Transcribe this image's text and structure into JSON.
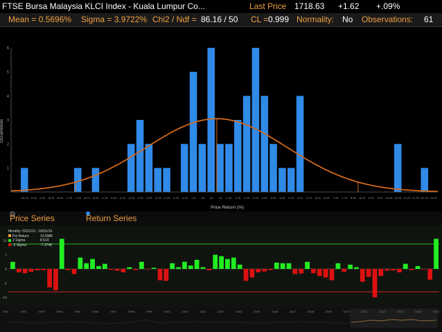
{
  "header": {
    "title": "FTSE Bursa Malaysia KLCI Index - Kuala Lumpur Co...",
    "last_price_label": "Last Price",
    "last_price": "1718.63",
    "change": "+1.62",
    "change_pct": "+.09%"
  },
  "stats": {
    "mean": "Mean = 0.5696%",
    "sigma": "Sigma = 3.9722%",
    "chi2_label": "Chi2 / Ndf =",
    "chi2_value": "86.16 / 50",
    "cl_label": "CL =",
    "cl_value": "0.999",
    "normality_label": "Normality:",
    "normality_value": "No",
    "observations_label": "Observations:",
    "observations_value": "61"
  },
  "tabs": {
    "price_series": "Price Series",
    "return_series": "Return Series"
  },
  "legend": {
    "period": "Monthly: 02/21/11 - 03/31/16",
    "pct_return_label": "Pct Return",
    "pct_return_value": "10.5986",
    "sigma2_label": "2 Sigma",
    "sigma2_value": "8.514",
    "neg_sigma2_label": "-2 Sigma",
    "neg_sigma2_value": "-7.3748"
  },
  "colors": {
    "bar": "#2f8ae8",
    "curve": "#d2691e",
    "pos": "#22ee22",
    "neg": "#dd1111",
    "label": "#f0a040"
  },
  "chart_data": [
    {
      "type": "bar",
      "title": "",
      "xlabel": "Price Return (%)",
      "ylabel": "Occurrences",
      "x": [
        -10.25,
        -7.25,
        -6.25,
        -4.25,
        -3.75,
        -3.25,
        -2.75,
        -2.25,
        -1.25,
        -0.75,
        -0.25,
        0.25,
        0.75,
        1.25,
        1.75,
        2.25,
        2.75,
        3.25,
        3.75,
        4.25,
        4.75,
        5.25,
        10.75,
        12.25
      ],
      "values": [
        1,
        1,
        1,
        2,
        3,
        2,
        1,
        1,
        2,
        5,
        2,
        6,
        2,
        2,
        3,
        4,
        6,
        4,
        2,
        1,
        1,
        4,
        2,
        1,
        1
      ],
      "bin_centers": [
        -10.25,
        -7.25,
        -6.25,
        -4.25,
        -3.75,
        -3.25,
        -2.75,
        -2.25,
        -1.25,
        -0.75,
        -0.25,
        0.25,
        0.75,
        1.25,
        1.75,
        2.25,
        2.75,
        3.25,
        3.75,
        4.25,
        4.75,
        5.25,
        10.75,
        12.25
      ],
      "counts": [
        1,
        1,
        1,
        2,
        3,
        2,
        1,
        1,
        2,
        5,
        2,
        6,
        2,
        2,
        3,
        4,
        6,
        4,
        2,
        1,
        1,
        4,
        2,
        1,
        1
      ],
      "ylim": [
        0,
        6
      ],
      "yticks": [
        "1",
        "2",
        "3",
        "4",
        "5",
        "6"
      ],
      "xticks": [
        "-10.25",
        "-9.75",
        "-9.25",
        "-8.75",
        "-8.25",
        "-7.75",
        "-7.25",
        "-6.75",
        "-6.25",
        "-5.75",
        "-5.25",
        "-4.75",
        "-4.25",
        "-3.75",
        "-3.25",
        "-2.75",
        "-2.25",
        "-1.75",
        "-1.25",
        "-.75",
        "-.25",
        ".25",
        ".75",
        "1.25",
        "1.75",
        "2.25",
        "2.75",
        "3.25",
        "3.75",
        "4.25",
        "4.75",
        "5.25",
        "5.75",
        "6.25",
        "6.75",
        "7.25",
        "7.75",
        "8.25",
        "8.75",
        "9.25",
        "9.75",
        "10.25",
        "10.75",
        "11.25",
        "11.75",
        "12.25",
        "12.75"
      ],
      "normal_fit": {
        "mean": 0.5696,
        "sigma": 3.9722
      },
      "grid": false
    },
    {
      "type": "bar",
      "title": "",
      "xlabel": "",
      "ylabel": "",
      "categories": [
        "1991",
        "1992",
        "1993",
        "1994",
        "1995",
        "1996",
        "1997",
        "1998",
        "1999",
        "2000",
        "2001",
        "2002",
        "2003",
        "2004",
        "2005",
        "2006",
        "2007",
        "2008",
        "2009",
        "2010",
        "2011",
        "2012",
        "2013",
        "2014",
        "2015"
      ],
      "yticks": [
        "10",
        "5",
        "0",
        "-5",
        "-10"
      ],
      "series": [
        {
          "values": [
            2.5,
            -1.2,
            -1.5,
            -1.0,
            -0.5,
            -0.4,
            -6.5,
            -7.5,
            10.6,
            -0.4,
            -1.8,
            4.0,
            2.0,
            3.5,
            1.0,
            1.8,
            -0.3,
            -0.6,
            -1.2,
            0.6,
            -0.4,
            2.5,
            -0.2,
            0.4,
            -4.0,
            -4.2,
            2.0,
            0.6,
            2.5,
            1.2,
            3.2,
            0.6,
            -0.5,
            5.0,
            4.5,
            3.5,
            4.0,
            1.5,
            -4.2,
            -3.0,
            -1.2,
            -0.9,
            -0.4,
            2.2,
            2.0,
            2.0,
            -1.8,
            -1.6,
            2.5,
            -1.5,
            -2.5,
            -3.0,
            -4.0,
            2.0,
            -1.0,
            1.5,
            0.6,
            -4.5,
            -2.8,
            -10.0,
            -2.5,
            -0.6,
            -0.5,
            -1.2,
            1.8,
            -0.4,
            1.0,
            -0.2,
            -3.8,
            10.6
          ]
        }
      ],
      "reference_lines": [
        8.514,
        -7.3748
      ]
    }
  ]
}
